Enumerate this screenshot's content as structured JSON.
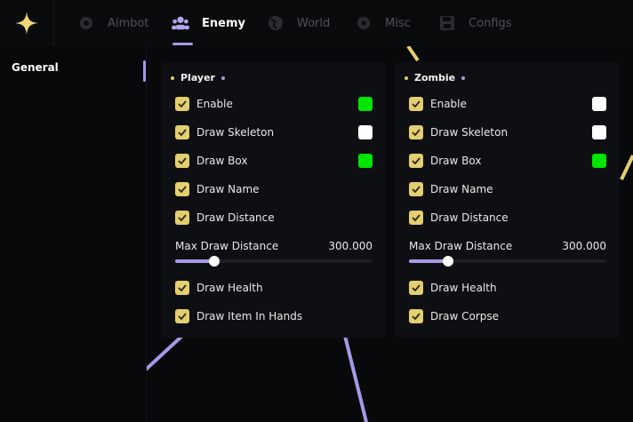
{
  "tabs": [
    {
      "label": "Aimbot",
      "icon": "gear-icon"
    },
    {
      "label": "Enemy",
      "icon": "users-icon"
    },
    {
      "label": "World",
      "icon": "globe-icon"
    },
    {
      "label": "Misc",
      "icon": "cog-icon"
    },
    {
      "label": "Configs",
      "icon": "save-icon"
    }
  ],
  "active_tab": "Enemy",
  "sidebar": {
    "items": [
      {
        "label": "General"
      }
    ]
  },
  "accent_color": "#a898e8",
  "checkbox_color": "#e3cf6f",
  "player": {
    "title": "Player",
    "enable": {
      "label": "Enable",
      "checked": true,
      "color": "#00e600"
    },
    "draw_skeleton": {
      "label": "Draw Skeleton",
      "checked": true,
      "color": "#ffffff"
    },
    "draw_box": {
      "label": "Draw Box",
      "checked": true,
      "color": "#00e600"
    },
    "draw_name": {
      "label": "Draw Name",
      "checked": true
    },
    "draw_distance": {
      "label": "Draw Distance",
      "checked": true
    },
    "max_draw_distance": {
      "label": "Max Draw Distance",
      "value": "300.000",
      "fill_fraction": 0.2
    },
    "draw_health": {
      "label": "Draw Health",
      "checked": true
    },
    "draw_item_in_hands": {
      "label": "Draw Item In Hands",
      "checked": true
    }
  },
  "zombie": {
    "title": "Zombie",
    "enable": {
      "label": "Enable",
      "checked": true,
      "color": "#ffffff"
    },
    "draw_skeleton": {
      "label": "Draw Skeleton",
      "checked": true,
      "color": "#ffffff"
    },
    "draw_box": {
      "label": "Draw Box",
      "checked": true,
      "color": "#00e600"
    },
    "draw_name": {
      "label": "Draw Name",
      "checked": true
    },
    "draw_distance": {
      "label": "Draw Distance",
      "checked": true
    },
    "max_draw_distance": {
      "label": "Max Draw Distance",
      "value": "300.000",
      "fill_fraction": 0.2
    },
    "draw_health": {
      "label": "Draw Health",
      "checked": true
    },
    "draw_corpse": {
      "label": "Draw Corpse",
      "checked": true
    }
  }
}
